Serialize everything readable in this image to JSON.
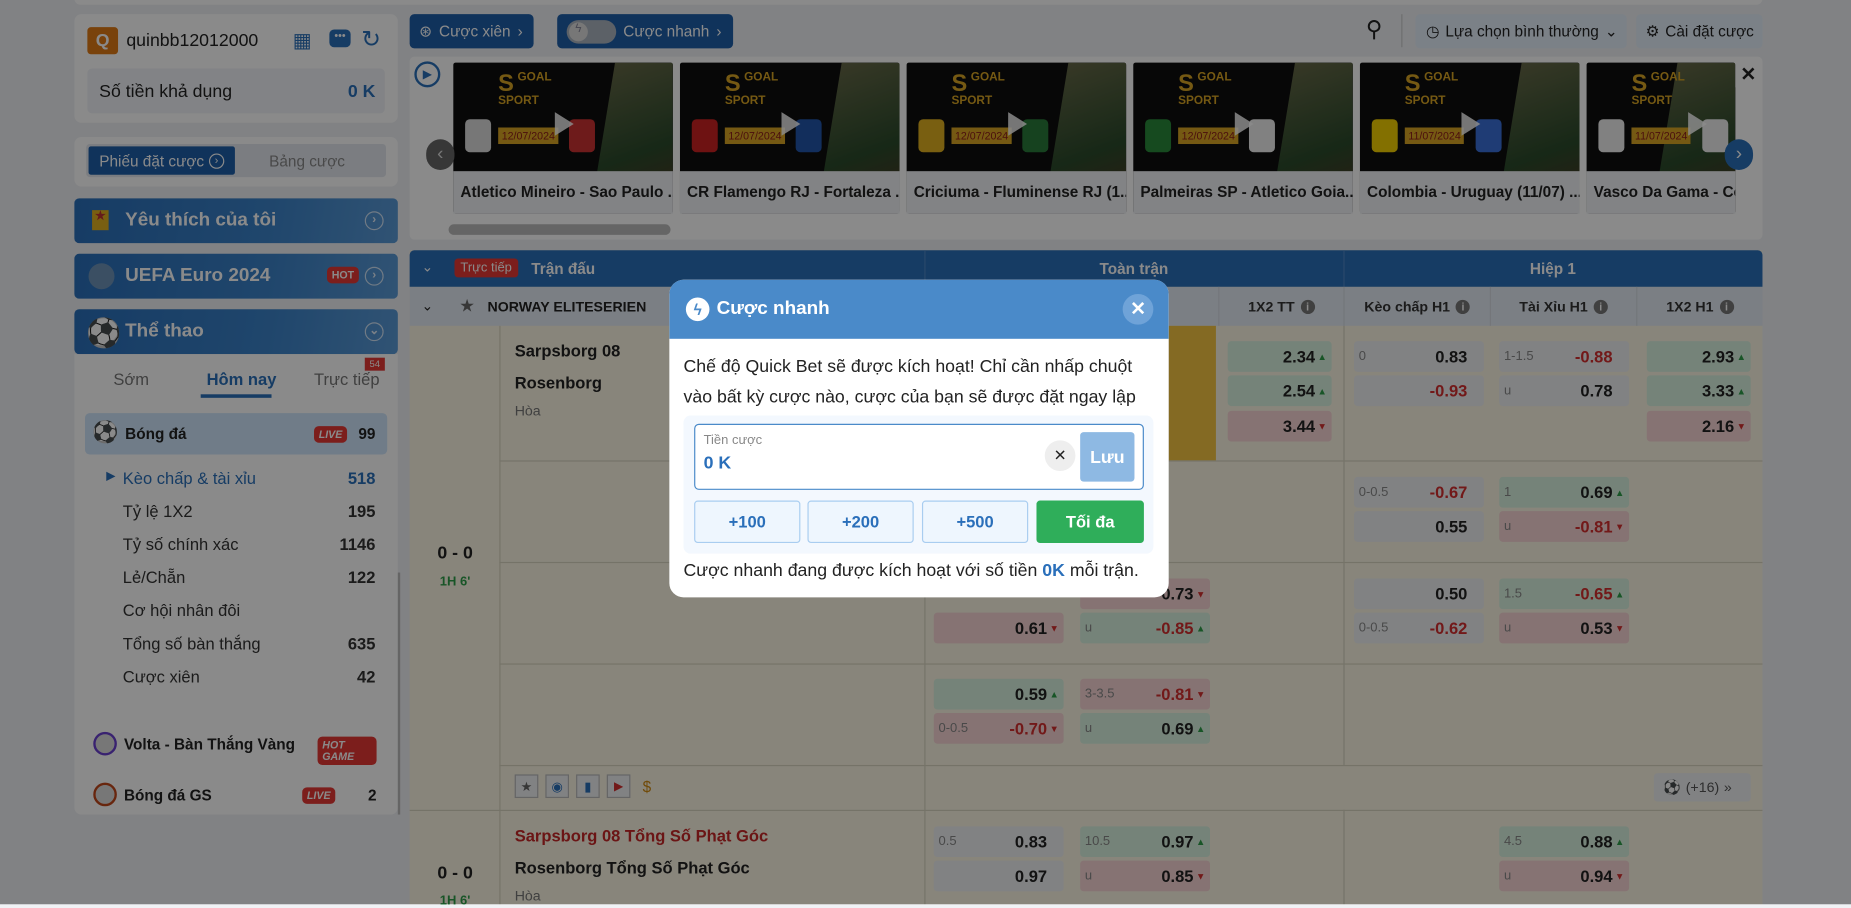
{
  "user": {
    "avatar_letter": "Q",
    "username": "quinbb12012000",
    "balance_label": "Số tiền khả dụng",
    "balance": "0 K"
  },
  "slip_tabs": {
    "active": "Phiếu đặt cược",
    "inactive": "Bảng cược"
  },
  "sidebar": {
    "favorites": "Yêu thích của tôi",
    "euro": "UEFA Euro 2024",
    "euro_badge": "HOT",
    "sports": "Thể thao",
    "time_tabs": [
      {
        "label": "Sớm"
      },
      {
        "label": "Hôm nay",
        "active": true
      },
      {
        "label": "Trực tiếp",
        "badge": "54"
      }
    ],
    "football": {
      "label": "Bóng đá",
      "badge": "LIVE",
      "count": "99"
    },
    "sub_items": [
      {
        "label": "Kèo chấp & tài xỉu",
        "count": "518",
        "active": true
      },
      {
        "label": "Tỷ lệ 1X2",
        "count": "195"
      },
      {
        "label": "Tỷ số chính xác",
        "count": "1146"
      },
      {
        "label": "Lẻ/Chẵn",
        "count": "122"
      },
      {
        "label": "Cơ hội nhân đôi",
        "count": ""
      },
      {
        "label": "Tổng số bàn thắng",
        "count": "635"
      },
      {
        "label": "Cược xiên",
        "count": "42"
      }
    ],
    "volta": {
      "label": "Volta - Bàn Thắng Vàng",
      "badge": "HOT GAME"
    },
    "gs": {
      "label": "Bóng đá GS",
      "badge": "LIVE",
      "count": "2"
    }
  },
  "toolbar": {
    "parlay": "Cược xiên",
    "quick_bet": "Cược nhanh",
    "view_select": "Lựa chọn bình thường",
    "settings": "Cài đặt cược"
  },
  "carousel": [
    {
      "title": "Atletico Mineiro - Sao Paulo ...",
      "date": "12/07/2024",
      "brand": "GOAL SPORT"
    },
    {
      "title": "CR Flamengo RJ - Fortaleza ...",
      "date": "12/07/2024",
      "brand": "GOAL SPORT"
    },
    {
      "title": "Criciuma - Fluminense RJ (1...",
      "date": "12/07/2024",
      "brand": "GOAL SPORT"
    },
    {
      "title": "Palmeiras SP - Atletico Goia...",
      "date": "12/07/2024",
      "brand": "GOAL SPORT"
    },
    {
      "title": "Colombia - Uruguay (11/07) ...",
      "date": "11/07/2024",
      "brand": "GOAL SPORT"
    },
    {
      "title": "Vasco Da Gama - Cor",
      "date": "11/07/2024",
      "brand": "GOAL SPORT"
    }
  ],
  "table": {
    "live_badge": "Trực tiếp",
    "match_col": "Trận đấu",
    "full_time": "Toàn trận",
    "first_half": "Hiệp 1",
    "league": "NORWAY ELITESERIEN",
    "sub_headers": [
      "1X2 TT",
      "Kèo chấp H1",
      "Tài Xỉu H1",
      "1X2 H1"
    ],
    "match1": {
      "home": "Sarpsborg 08",
      "away": "Rosenborg",
      "draw": "Hòa",
      "score": "0 - 0",
      "time": "1H 6'",
      "more": "(+16)"
    },
    "match2": {
      "home": "Sarpsborg 08 Tổng Số Phạt Góc",
      "away": "Rosenborg Tổng Số Phạt Góc",
      "draw": "Hòa",
      "score": "0 - 0",
      "time": "1H 6'"
    },
    "odds_rows": [
      [
        {
          "c": 3,
          "l": 0,
          "v": "2.34",
          "d": "up",
          "k": "g"
        },
        {
          "c": 3,
          "l": 1,
          "v": "2.54",
          "d": "up",
          "k": "g"
        },
        {
          "c": 3,
          "l": 2,
          "v": "3.44",
          "d": "dn",
          "k": "r"
        },
        {
          "c": 4,
          "l": 0,
          "line": "0",
          "v": "0.83",
          "k": "n"
        },
        {
          "c": 4,
          "l": 1,
          "v": "-0.93",
          "k": "n"
        },
        {
          "c": 5,
          "l": 0,
          "line": "1-1.5",
          "v": "-0.88",
          "k": "n"
        },
        {
          "c": 5,
          "l": 1,
          "line": "u",
          "v": "0.78",
          "k": "n"
        },
        {
          "c": 6,
          "l": 0,
          "v": "2.93",
          "d": "up",
          "k": "g"
        },
        {
          "c": 6,
          "l": 1,
          "v": "3.33",
          "d": "up",
          "k": "g"
        },
        {
          "c": 6,
          "l": 2,
          "v": "2.16",
          "d": "dn",
          "k": "r"
        }
      ],
      [
        {
          "c": 4,
          "l": 0,
          "line": "0-0.5",
          "v": "-0.67",
          "k": "n"
        },
        {
          "c": 4,
          "l": 1,
          "v": "0.55",
          "k": "n"
        },
        {
          "c": 5,
          "l": 0,
          "line": "1",
          "v": "0.69",
          "d": "up",
          "k": "g"
        },
        {
          "c": 5,
          "l": 1,
          "line": "u",
          "v": "-0.81",
          "d": "dn",
          "k": "r"
        }
      ],
      [
        {
          "c": 1,
          "l": 1,
          "v": "0.61",
          "d": "dn",
          "k": "r"
        },
        {
          "c": 2,
          "l": 0,
          "v": "0.73",
          "d": "dn",
          "k": "r"
        },
        {
          "c": 2,
          "l": 1,
          "line": "u",
          "v": "-0.85",
          "d": "up",
          "k": "g"
        },
        {
          "c": 4,
          "l": 0,
          "v": "0.50",
          "k": "n"
        },
        {
          "c": 4,
          "l": 1,
          "line": "0-0.5",
          "v": "-0.62",
          "k": "n"
        },
        {
          "c": 5,
          "l": 0,
          "line": "1.5",
          "v": "-0.65",
          "d": "up",
          "k": "g"
        },
        {
          "c": 5,
          "l": 1,
          "line": "u",
          "v": "0.53",
          "d": "dn",
          "k": "r"
        }
      ],
      [
        {
          "c": 1,
          "l": 0,
          "v": "0.59",
          "d": "up",
          "k": "g"
        },
        {
          "c": 1,
          "l": 1,
          "line": "0-0.5",
          "v": "-0.70",
          "d": "dn",
          "k": "r"
        },
        {
          "c": 2,
          "l": 0,
          "line": "3-3.5",
          "v": "-0.81",
          "d": "dn",
          "k": "r"
        },
        {
          "c": 2,
          "l": 1,
          "line": "u",
          "v": "0.69",
          "d": "up",
          "k": "g"
        }
      ],
      [
        {
          "c": 1,
          "l": 0,
          "line": "0.5",
          "v": "0.83",
          "k": "n"
        },
        {
          "c": 1,
          "l": 1,
          "v": "0.97",
          "k": "n"
        },
        {
          "c": 2,
          "l": 0,
          "line": "10.5",
          "v": "0.97",
          "d": "up",
          "k": "g"
        },
        {
          "c": 2,
          "l": 1,
          "line": "u",
          "v": "0.85",
          "d": "dn",
          "k": "r"
        },
        {
          "c": 5,
          "l": 0,
          "line": "4.5",
          "v": "0.88",
          "d": "up",
          "k": "g"
        },
        {
          "c": 5,
          "l": 1,
          "line": "u",
          "v": "0.94",
          "d": "dn",
          "k": "r"
        }
      ]
    ]
  },
  "modal": {
    "title": "Cược nhanh",
    "desc": "Chế độ Quick Bet sẽ được kích hoạt! Chỉ cần nhấp chuột vào bất kỳ cược nào, cược của bạn sẽ được đặt ngay lập tức.",
    "stake_label": "Tiền cược",
    "stake_value": "0 K",
    "save": "Lưu",
    "quick": [
      "+100",
      "+200",
      "+500"
    ],
    "max": "Tối đa",
    "footer_pre": "Cược nhanh đang được kích hoạt với số tiền ",
    "footer_amount": "0K",
    "footer_post": " mỗi trận."
  },
  "colors": {
    "primary": "#1f5fa8",
    "modal_header": "#4a8ac9",
    "max_button": "#2fae5a",
    "live_red": "#e53935"
  }
}
